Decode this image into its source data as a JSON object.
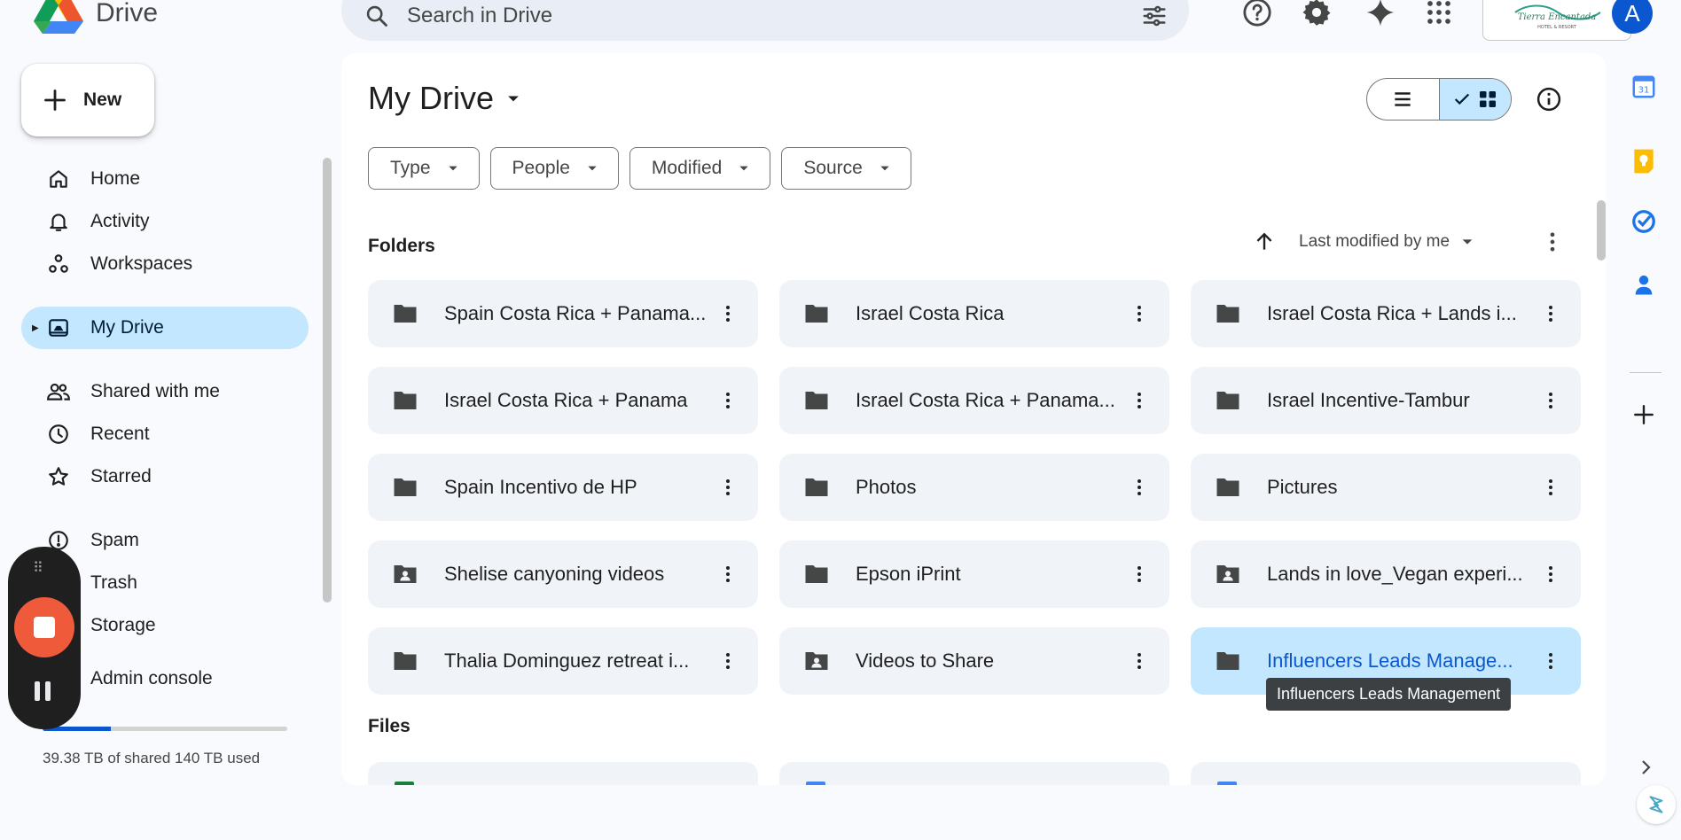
{
  "app": {
    "name": "Drive"
  },
  "search": {
    "placeholder": "Search in Drive"
  },
  "account": {
    "avatar_letter": "A"
  },
  "new_button": {
    "label": "New"
  },
  "nav": {
    "items": [
      {
        "label": "Home",
        "icon": "home-icon"
      },
      {
        "label": "Activity",
        "icon": "bell-icon"
      },
      {
        "label": "Workspaces",
        "icon": "workspaces-icon"
      },
      {
        "label": "My Drive",
        "icon": "drive-icon",
        "active": true
      },
      {
        "label": "Shared with me",
        "icon": "people-icon"
      },
      {
        "label": "Recent",
        "icon": "clock-icon"
      },
      {
        "label": "Starred",
        "icon": "star-icon"
      },
      {
        "label": "Spam",
        "icon": "spam-icon"
      },
      {
        "label": "Trash",
        "icon": "trash-icon"
      },
      {
        "label": "Storage",
        "icon": "cloud-icon"
      },
      {
        "label": "Admin console",
        "icon": "admin-icon"
      }
    ],
    "storage_text": "39.38 TB of shared 140 TB used",
    "storage_fraction": 0.28
  },
  "main": {
    "title": "My Drive",
    "filters": [
      "Type",
      "People",
      "Modified",
      "Source"
    ],
    "folders_label": "Folders",
    "files_label": "Files",
    "sort_label": "Last modified by me",
    "folders": [
      {
        "name": "Spain Costa Rica + Panama...",
        "shared": false
      },
      {
        "name": "Israel Costa Rica",
        "shared": false
      },
      {
        "name": "Israel Costa Rica + Lands i...",
        "shared": false
      },
      {
        "name": "Israel Costa Rica + Panama",
        "shared": false
      },
      {
        "name": "Israel Costa Rica + Panama...",
        "shared": false
      },
      {
        "name": "Israel Incentive-Tambur",
        "shared": false
      },
      {
        "name": "Spain Incentivo de HP",
        "shared": false
      },
      {
        "name": "Photos",
        "shared": false
      },
      {
        "name": "Pictures",
        "shared": false
      },
      {
        "name": "Shelise canyoning videos",
        "shared": true
      },
      {
        "name": "Epson iPrint",
        "shared": false
      },
      {
        "name": "Lands in love_Vegan experi...",
        "shared": true
      },
      {
        "name": "Thalia Dominguez retreat i...",
        "shared": false
      },
      {
        "name": "Videos to Share",
        "shared": true
      },
      {
        "name": "Influencers Leads Manage...",
        "shared": false,
        "selected": true
      }
    ],
    "tooltip": "Influencers Leads Management"
  },
  "colors": {
    "accent": "#0b57d0",
    "selected_bg": "#c2e7ff",
    "card_bg": "#f0f4f9",
    "record_red": "#ee5a3a"
  }
}
